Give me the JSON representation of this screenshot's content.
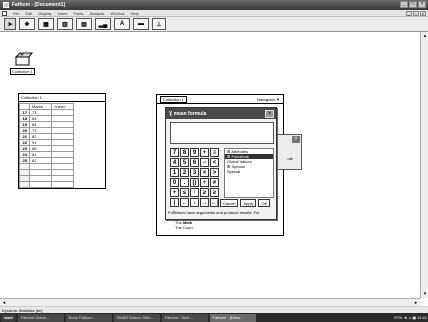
{
  "window": {
    "title": "Fathom - [Document1]"
  },
  "menu": [
    "File",
    "Edit",
    "Display",
    "Insert",
    "Fonts",
    "Analysis",
    "Window",
    "Help"
  ],
  "toolbar": [
    "select",
    "collection",
    "case-table",
    "graph",
    "summary-table",
    "estimate",
    "text",
    "slider",
    "chart"
  ],
  "shelf": {
    "label": "Collection 1"
  },
  "case_table": {
    "title": "Collection 1",
    "columns": [
      "Marks",
      "<new>"
    ],
    "rows": [
      {
        "idx": "17",
        "val": "73"
      },
      {
        "idx": "18",
        "val": "84"
      },
      {
        "idx": "19",
        "val": "84"
      },
      {
        "idx": "20",
        "val": "73"
      },
      {
        "idx": "21",
        "val": "82"
      },
      {
        "idx": "22",
        "val": "91"
      },
      {
        "idx": "23",
        "val": "88"
      },
      {
        "idx": "24",
        "val": "81"
      },
      {
        "idx": "25",
        "val": "82"
      },
      {
        "idx": "",
        "val": ""
      },
      {
        "idx": "",
        "val": ""
      },
      {
        "idx": "",
        "val": ""
      },
      {
        "idx": "",
        "val": ""
      }
    ]
  },
  "graph": {
    "collection": "Collection 1",
    "plot_type": "Histogram ▼",
    "text": {
      "line1_pre": "The ",
      "line1_bold": "Mark",
      "line2": "The Coun"
    }
  },
  "back_dialog": {
    "label": "ute"
  },
  "formula": {
    "title": "mean formula",
    "keys": [
      [
        "7",
        "8",
        "9",
        "+",
        "≡"
      ],
      [
        "4",
        "5",
        "6",
        "−",
        "<"
      ],
      [
        "1",
        "2",
        "3",
        "×",
        ">"
      ],
      [
        "0",
        ".",
        "()",
        "÷",
        "≠"
      ],
      [
        "+",
        "≤",
        "↑",
        "≥",
        "≥"
      ],
      [
        "|←",
        "←",
        "↓",
        "→",
        "←|"
      ]
    ],
    "tree": [
      "⊞ Attributes",
      "⊞ Functions",
      "  Global Values",
      "⊞ Special",
      "  Special"
    ],
    "tree_selected": 1,
    "buttons": [
      "Cancel",
      "Apply",
      "OK"
    ],
    "hint": "Functions have arguments and produce results. For"
  },
  "status": {
    "text": "Dynamic Statistics [tm]"
  },
  "taskbar": {
    "start": "start",
    "tasks": [
      "Fathom Diarie...",
      "Book Fathom...",
      "SMARTAlbum 99th...",
      "Fathom / Sket...",
      "Fathom - [Docu..."
    ],
    "active_index": 4,
    "tray": "97%  ◄ ♫ ▣  11:41"
  }
}
